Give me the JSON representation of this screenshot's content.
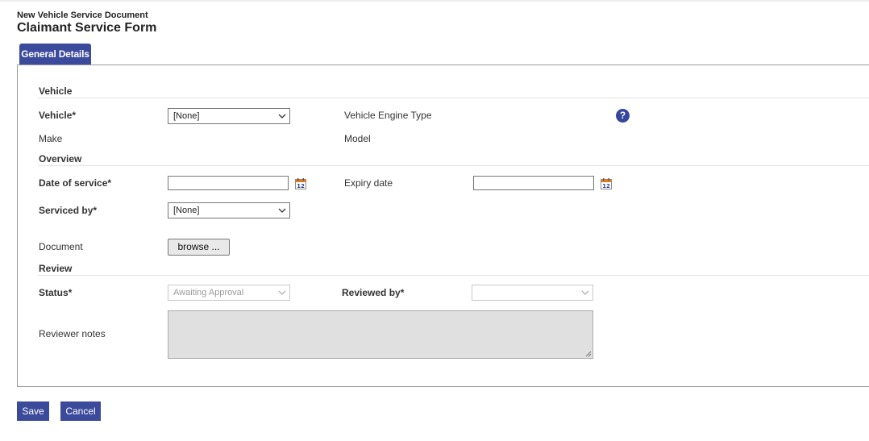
{
  "header": {
    "document_type": "New Vehicle Service Document",
    "title": "Claimant Service Form"
  },
  "tabs": [
    {
      "label": "General Details",
      "active": true
    }
  ],
  "sections": {
    "vehicle": {
      "title": "Vehicle",
      "vehicle_label": "Vehicle*",
      "vehicle_value": "[None]",
      "engine_type_label": "Vehicle Engine Type",
      "make_label": "Make",
      "model_label": "Model"
    },
    "overview": {
      "title": "Overview",
      "date_of_service_label": "Date of service*",
      "date_of_service_value": "",
      "expiry_date_label": "Expiry date",
      "expiry_date_value": "",
      "serviced_by_label": "Serviced by*",
      "serviced_by_value": "[None]",
      "document_label": "Document",
      "browse_label": "browse ..."
    },
    "review": {
      "title": "Review",
      "status_label": "Status*",
      "status_value": "Awaiting Approval",
      "reviewed_by_label": "Reviewed by*",
      "reviewed_by_value": "",
      "reviewer_notes_label": "Reviewer notes",
      "reviewer_notes_value": ""
    }
  },
  "actions": {
    "save_label": "Save",
    "cancel_label": "Cancel"
  },
  "icons": {
    "help": "question-mark-icon",
    "calendar": "calendar-icon",
    "dropdown": "chevron-down-icon"
  },
  "colors": {
    "accent": "#3c4a9c",
    "help_icon": "#35469b",
    "calendar_orange": "#e07b24",
    "disabled_bg": "#e0e0e0"
  }
}
